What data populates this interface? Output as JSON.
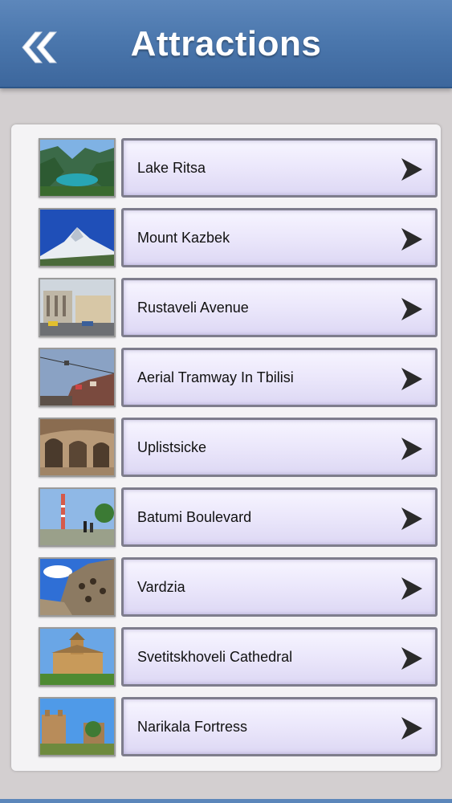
{
  "header": {
    "title": "Attractions",
    "back_icon": "double-chevron-left-icon"
  },
  "colors": {
    "header": "#4b77ad",
    "background": "#d3cfd0",
    "panel": "#f4f3f5",
    "button_border": "#7e7d8c",
    "chevron": "#2a2a2a"
  },
  "attractions": [
    {
      "label": "Lake Ritsa",
      "thumb": "mountain-lake-photo"
    },
    {
      "label": "Mount Kazbek",
      "thumb": "snowy-mountain-photo"
    },
    {
      "label": "Rustaveli Avenue",
      "thumb": "city-street-photo"
    },
    {
      "label": "Aerial Tramway In Tbilisi",
      "thumb": "cable-car-city-photo"
    },
    {
      "label": "Uplistsicke",
      "thumb": "cave-town-photo"
    },
    {
      "label": "Batumi Boulevard",
      "thumb": "boulevard-tower-photo"
    },
    {
      "label": "Vardzia",
      "thumb": "cliff-monastery-photo"
    },
    {
      "label": "Svetitskhoveli Cathedral",
      "thumb": "cathedral-photo"
    },
    {
      "label": "Narikala Fortress",
      "thumb": "fortress-photo"
    }
  ]
}
